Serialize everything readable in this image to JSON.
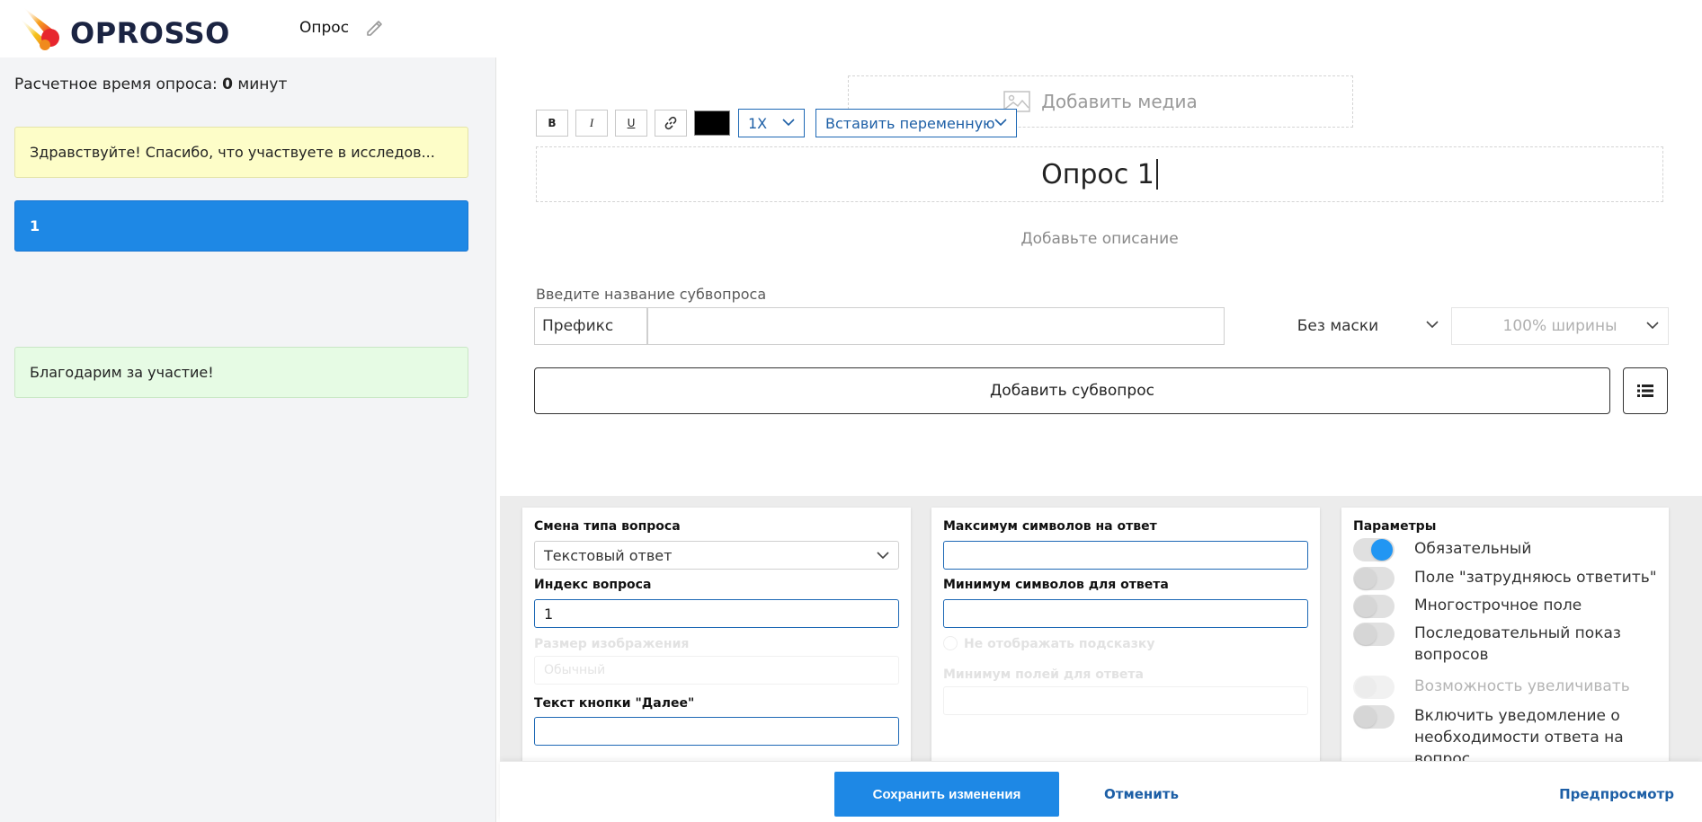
{
  "brand": {
    "logo_text": "OPROSSO"
  },
  "header": {
    "survey_name": "Опрос"
  },
  "sidebar": {
    "est_time_label": "Расчетное время опроса:",
    "est_time_value": "0",
    "est_time_unit": "минут",
    "cards": [
      {
        "label": "Здравствуйте! Спасибо, что участвуете в исследов..."
      },
      {
        "label": "1"
      },
      {
        "label": "Благодарим за участие!"
      }
    ]
  },
  "editor": {
    "add_media_label": "Добавить медиа",
    "toolbar": {
      "bold": "B",
      "italic": "I",
      "underline": "U",
      "size_value": "1X",
      "variable_label": "Вставить переменную",
      "text_color": "#000000"
    },
    "title": "Опрос 1",
    "description_placeholder": "Добавьте описание",
    "subquestion_label": "Введите название субвопроса",
    "prefix_label": "Префикс",
    "mask_value": "Без маски",
    "width_value": "100% ширины",
    "add_subquestion_label": "Добавить субвопрос"
  },
  "settings": {
    "panel1": {
      "type_label": "Смена типа вопроса",
      "type_value": "Текстовый ответ",
      "index_label": "Индекс вопроса",
      "index_value": "1",
      "image_size_label": "Размер изображения",
      "image_size_value": "Обычный",
      "next_button_label": "Текст кнопки \"Далее\""
    },
    "panel2": {
      "max_chars_label": "Максимум символов на ответ",
      "min_chars_label": "Минимум символов для ответа",
      "hide_hint_label": "Не отображать подсказку",
      "min_fields_label": "Минимум полей для ответа"
    },
    "panel3": {
      "title": "Параметры",
      "toggles": [
        {
          "label": "Обязательный",
          "state": "on"
        },
        {
          "label": "Поле \"затрудняюсь ответить\"",
          "state": "off"
        },
        {
          "label": "Многострочное поле",
          "state": "off"
        },
        {
          "label": "Последовательный показ вопросов",
          "state": "off"
        },
        {
          "label": "Возможность увеличивать",
          "state": "disabled"
        },
        {
          "label": "Включить уведомление о необходимости ответа на вопрос",
          "state": "off"
        }
      ]
    }
  },
  "footer": {
    "save_label": "Сохранить изменения",
    "cancel_label": "Отменить",
    "preview_label": "Предпросмотр"
  },
  "colors": {
    "accent": "#1e88e5",
    "link": "#1d5fa6",
    "welcome_card": "#fdfdc8",
    "thanks_card": "#e6fbe4"
  }
}
